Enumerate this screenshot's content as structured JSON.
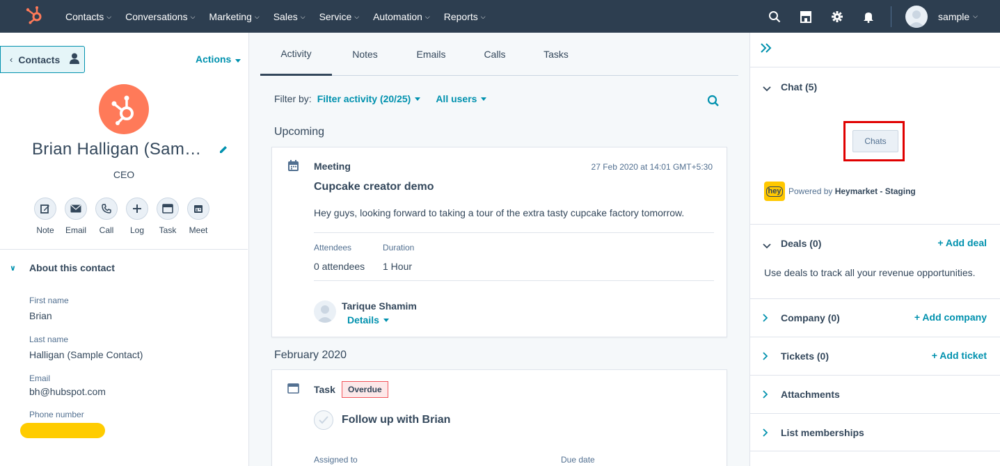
{
  "topnav": {
    "items": [
      {
        "label": "Contacts"
      },
      {
        "label": "Conversations"
      },
      {
        "label": "Marketing"
      },
      {
        "label": "Sales"
      },
      {
        "label": "Service"
      },
      {
        "label": "Automation"
      },
      {
        "label": "Reports"
      }
    ],
    "account_name": "sample"
  },
  "left": {
    "back_label": "Contacts",
    "actions_label": "Actions",
    "contact_name": "Brian Halligan (Sam…",
    "contact_title": "CEO",
    "quick_actions": [
      {
        "label": "Note"
      },
      {
        "label": "Email"
      },
      {
        "label": "Call"
      },
      {
        "label": "Log"
      },
      {
        "label": "Task"
      },
      {
        "label": "Meet"
      }
    ],
    "about_title": "About this contact",
    "fields": [
      {
        "label": "First name",
        "value": "Brian"
      },
      {
        "label": "Last name",
        "value": "Halligan (Sample Contact)"
      },
      {
        "label": "Email",
        "value": "bh@hubspot.com"
      },
      {
        "label": "Phone number",
        "value": ""
      }
    ]
  },
  "mid": {
    "tabs": [
      {
        "label": "Activity"
      },
      {
        "label": "Notes"
      },
      {
        "label": "Emails"
      },
      {
        "label": "Calls"
      },
      {
        "label": "Tasks"
      }
    ],
    "filter_by": "Filter by:",
    "filter_activity": "Filter activity (20/25)",
    "all_users": "All users",
    "upcoming": "Upcoming",
    "meeting": {
      "type": "Meeting",
      "timestamp": "27 Feb 2020 at 14:01 GMT+5:30",
      "title": "Cupcake creator demo",
      "body": "Hey guys, looking forward to taking a tour of the extra tasty cupcake factory tomorrow.",
      "attendees_label": "Attendees",
      "attendees_value": "0 attendees",
      "duration_label": "Duration",
      "duration_value": "1 Hour",
      "organizer": "Tarique Shamim",
      "details_label": "Details"
    },
    "month_header": "February 2020",
    "task": {
      "type": "Task",
      "badge": "Overdue",
      "title": "Follow up with Brian",
      "assigned_label": "Assigned to",
      "due_label": "Due date"
    }
  },
  "right": {
    "chat": {
      "title": "Chat (5)",
      "button": "Chats",
      "powered_prefix": "Powered by ",
      "powered_name": "Heymarket - Staging",
      "logo_text": "hey"
    },
    "deals": {
      "title": "Deals (0)",
      "action": "+ Add deal",
      "desc": "Use deals to track all your revenue opportunities."
    },
    "company": {
      "title": "Company (0)",
      "action": "+ Add company"
    },
    "tickets": {
      "title": "Tickets (0)",
      "action": "+ Add ticket"
    },
    "attachments": {
      "title": "Attachments"
    },
    "lists": {
      "title": "List memberships"
    }
  },
  "colors": {
    "nav_bg": "#2d3e50",
    "brand_orange": "#ff7a59",
    "link": "#0091ae",
    "highlight_red": "#e00000",
    "phone_redaction": "#ffcc00"
  }
}
